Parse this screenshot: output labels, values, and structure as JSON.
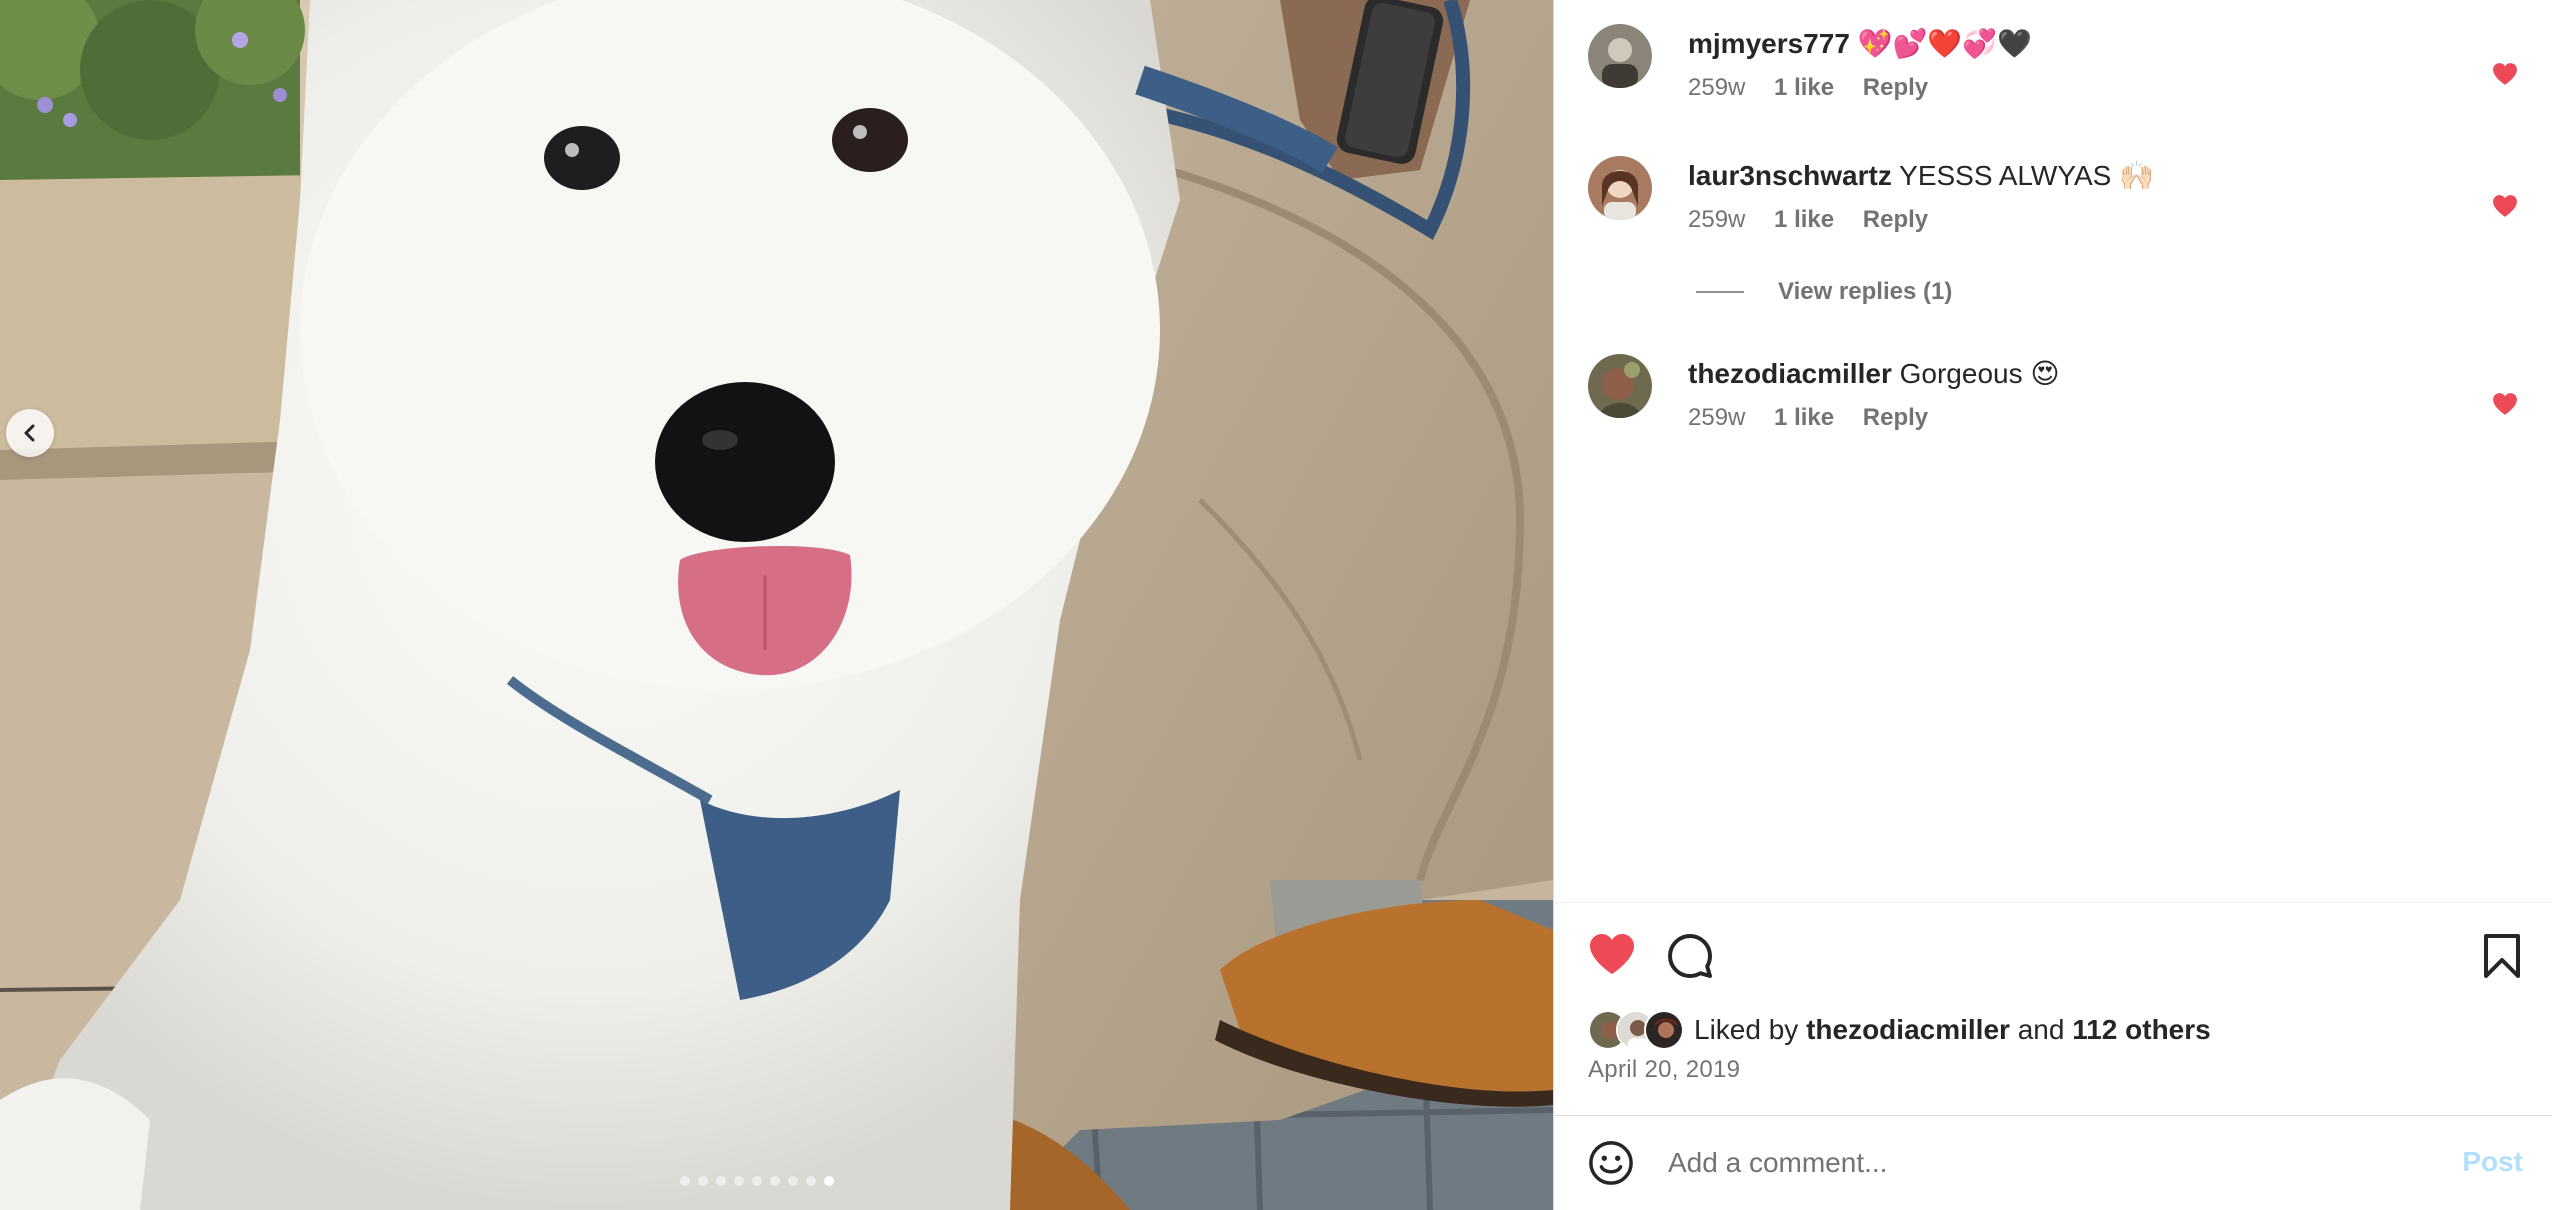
{
  "photo": {
    "alt": "White fluffy puppy with a blue harness sitting beside a person in khaki pants",
    "carousel": {
      "total": 9,
      "active_index": 8
    }
  },
  "comments": [
    {
      "username": "mjmyers777",
      "text": "💖💕❤️💞🖤",
      "age": "259w",
      "likes": "1 like",
      "reply": "Reply",
      "liked": true
    },
    {
      "username": "laur3nschwartz",
      "text": "YESSS ALWYAS 🙌🏻",
      "age": "259w",
      "likes": "1 like",
      "reply": "Reply",
      "liked": true
    },
    {
      "username": "thezodiacmiller",
      "text": "Gorgeous 😍",
      "age": "259w",
      "likes": "1 like",
      "reply": "Reply",
      "liked": true
    }
  ],
  "view_replies": "View replies (1)",
  "actions": {
    "liked": true,
    "like_icon": "heart-icon",
    "comment_icon": "comment-bubble-icon",
    "save_icon": "bookmark-icon"
  },
  "likes_summary": {
    "prefix": "Liked by",
    "user": "thezodiacmiller",
    "joiner": "and",
    "others": "112 others"
  },
  "post_date": "April 20, 2019",
  "comment_box": {
    "placeholder": "Add a comment...",
    "post_label": "Post"
  },
  "colors": {
    "heart_red": "#ed4956",
    "post_disabled": "#b2dffc",
    "secondary_text": "#737373"
  }
}
